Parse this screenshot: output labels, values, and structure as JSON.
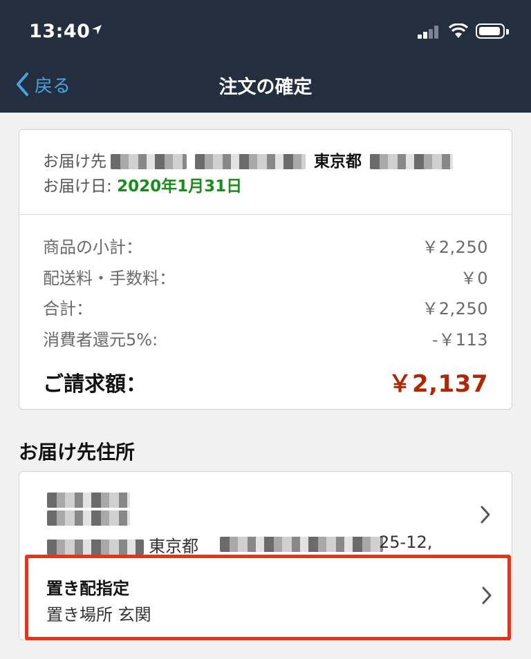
{
  "status_bar": {
    "time": "13:40"
  },
  "nav": {
    "back_label": "戻る",
    "title": "注文の確定"
  },
  "delivery": {
    "to_label": "お届け先",
    "to_city": "東京都",
    "date_label": "お届け日:",
    "date_value": "2020年1月31日"
  },
  "summary": {
    "rows": [
      {
        "label": "商品の小計：",
        "value": "￥2,250"
      },
      {
        "label": "配送料・手数料：",
        "value": "￥0"
      },
      {
        "label": "合計：",
        "value": "￥2,250"
      },
      {
        "label": "消費者還元5%:",
        "value": "-￥113"
      }
    ],
    "total_label": "ご請求額：",
    "total_value": "￥2,137"
  },
  "address_section": {
    "title": "お届け先住所",
    "city": "東京都",
    "number": "25-12,"
  },
  "okihai": {
    "title": "置き配指定",
    "subtitle": "置き場所 玄関"
  },
  "colors": {
    "header_bg": "#232f3e",
    "link": "#4aa3df",
    "date_green": "#1a8c1a",
    "total_red": "#b12704",
    "highlight_red": "#e8321c"
  }
}
